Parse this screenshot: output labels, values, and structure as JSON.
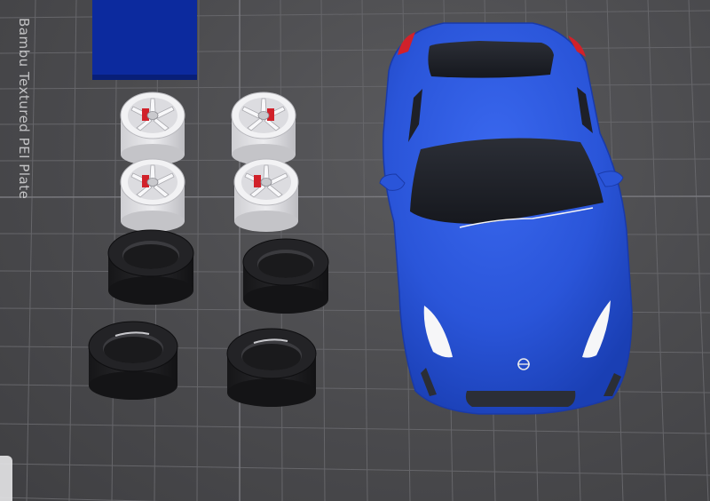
{
  "plate": {
    "label": "Bambu Textured PEI Plate"
  },
  "colors": {
    "plate_bg": "#4a4a4c",
    "grid": "#6a6a6e",
    "car_body": "#2a55d9",
    "block": "#0c2a9e",
    "wheel": "#e3e3e6",
    "brake": "#d1212a",
    "tire": "#1c1c1e"
  },
  "objects": [
    {
      "name": "blue-block"
    },
    {
      "name": "wheel"
    },
    {
      "name": "tire"
    },
    {
      "name": "car-body"
    }
  ]
}
